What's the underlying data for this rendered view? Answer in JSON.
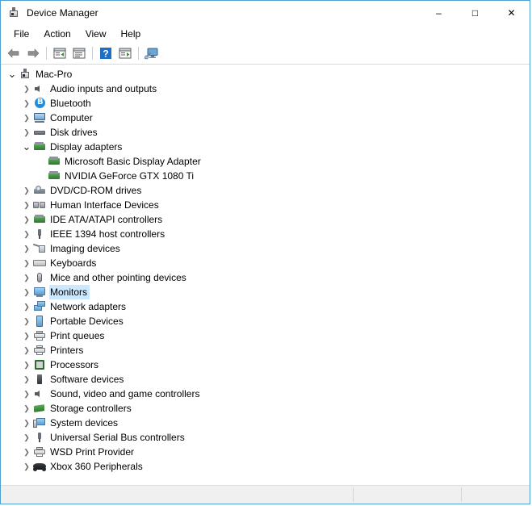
{
  "window": {
    "title": "Device Manager",
    "title_icon": "device-manager-icon",
    "controls": {
      "minimize": "–",
      "maximize": "□",
      "close": "✕"
    }
  },
  "menu": {
    "items": [
      {
        "label": "File",
        "name": "menu-file"
      },
      {
        "label": "Action",
        "name": "menu-action"
      },
      {
        "label": "View",
        "name": "menu-view"
      },
      {
        "label": "Help",
        "name": "menu-help"
      }
    ]
  },
  "toolbar": {
    "buttons": [
      {
        "name": "back-button",
        "icon": "back-arrow-icon",
        "type": "arrow-left"
      },
      {
        "name": "forward-button",
        "icon": "forward-arrow-icon",
        "type": "arrow-right"
      },
      {
        "name": "separator-1",
        "icon": "separator",
        "type": "sep"
      },
      {
        "name": "show-hide-console-tree-button",
        "icon": "console-tree-icon",
        "type": "tree"
      },
      {
        "name": "properties-button",
        "icon": "properties-icon",
        "type": "props"
      },
      {
        "name": "separator-2",
        "icon": "separator",
        "type": "sep"
      },
      {
        "name": "help-button",
        "icon": "help-question-icon",
        "type": "help"
      },
      {
        "name": "scan-hardware-changes-button",
        "icon": "scan-hardware-icon",
        "type": "scan"
      },
      {
        "name": "separator-3",
        "icon": "separator",
        "type": "sep"
      },
      {
        "name": "update-driver-button",
        "icon": "monitor-update-icon",
        "type": "monitor"
      }
    ]
  },
  "tree": {
    "selected_label": "Monitors",
    "nodes": [
      {
        "label": "Mac-Pro",
        "depth": 0,
        "state": "expanded",
        "icon": "computer-root-icon",
        "selected": false
      },
      {
        "label": "Audio inputs and outputs",
        "depth": 1,
        "state": "collapsed",
        "icon": "speaker-icon",
        "selected": false
      },
      {
        "label": "Bluetooth",
        "depth": 1,
        "state": "collapsed",
        "icon": "bluetooth-icon",
        "selected": false
      },
      {
        "label": "Computer",
        "depth": 1,
        "state": "collapsed",
        "icon": "computer-icon",
        "selected": false
      },
      {
        "label": "Disk drives",
        "depth": 1,
        "state": "collapsed",
        "icon": "disk-drive-icon",
        "selected": false
      },
      {
        "label": "Display adapters",
        "depth": 1,
        "state": "expanded",
        "icon": "display-adapter-icon",
        "selected": false
      },
      {
        "label": "Microsoft Basic Display Adapter",
        "depth": 2,
        "state": "leaf",
        "icon": "display-adapter-icon",
        "selected": false
      },
      {
        "label": "NVIDIA GeForce GTX 1080 Ti",
        "depth": 2,
        "state": "leaf",
        "icon": "display-adapter-icon",
        "selected": false
      },
      {
        "label": "DVD/CD-ROM drives",
        "depth": 1,
        "state": "collapsed",
        "icon": "dvd-drive-icon",
        "selected": false
      },
      {
        "label": "Human Interface Devices",
        "depth": 1,
        "state": "collapsed",
        "icon": "hid-icon",
        "selected": false
      },
      {
        "label": "IDE ATA/ATAPI controllers",
        "depth": 1,
        "state": "collapsed",
        "icon": "ide-controller-icon",
        "selected": false
      },
      {
        "label": "IEEE 1394 host controllers",
        "depth": 1,
        "state": "collapsed",
        "icon": "firewire-icon",
        "selected": false
      },
      {
        "label": "Imaging devices",
        "depth": 1,
        "state": "collapsed",
        "icon": "imaging-device-icon",
        "selected": false
      },
      {
        "label": "Keyboards",
        "depth": 1,
        "state": "collapsed",
        "icon": "keyboard-icon",
        "selected": false
      },
      {
        "label": "Mice and other pointing devices",
        "depth": 1,
        "state": "collapsed",
        "icon": "mouse-icon",
        "selected": false
      },
      {
        "label": "Monitors",
        "depth": 1,
        "state": "collapsed",
        "icon": "monitor-icon",
        "selected": true
      },
      {
        "label": "Network adapters",
        "depth": 1,
        "state": "collapsed",
        "icon": "network-adapter-icon",
        "selected": false
      },
      {
        "label": "Portable Devices",
        "depth": 1,
        "state": "collapsed",
        "icon": "portable-device-icon",
        "selected": false
      },
      {
        "label": "Print queues",
        "depth": 1,
        "state": "collapsed",
        "icon": "printer-icon",
        "selected": false
      },
      {
        "label": "Printers",
        "depth": 1,
        "state": "collapsed",
        "icon": "printer-icon",
        "selected": false
      },
      {
        "label": "Processors",
        "depth": 1,
        "state": "collapsed",
        "icon": "processor-icon",
        "selected": false
      },
      {
        "label": "Software devices",
        "depth": 1,
        "state": "collapsed",
        "icon": "software-device-icon",
        "selected": false
      },
      {
        "label": "Sound, video and game controllers",
        "depth": 1,
        "state": "collapsed",
        "icon": "speaker-icon",
        "selected": false
      },
      {
        "label": "Storage controllers",
        "depth": 1,
        "state": "collapsed",
        "icon": "storage-controller-icon",
        "selected": false
      },
      {
        "label": "System devices",
        "depth": 1,
        "state": "collapsed",
        "icon": "system-device-icon",
        "selected": false
      },
      {
        "label": "Universal Serial Bus controllers",
        "depth": 1,
        "state": "collapsed",
        "icon": "usb-icon",
        "selected": false
      },
      {
        "label": "WSD Print Provider",
        "depth": 1,
        "state": "collapsed",
        "icon": "printer-icon",
        "selected": false
      },
      {
        "label": "Xbox 360 Peripherals",
        "depth": 1,
        "state": "collapsed",
        "icon": "gamepad-icon",
        "selected": false
      }
    ],
    "expander_glyphs": {
      "collapsed": "❯",
      "expanded": "⌄"
    }
  },
  "statusbar": {
    "panes": [
      "",
      "",
      ""
    ]
  },
  "colors": {
    "window_border": "#4f9fd4",
    "selection": "#cce8ff",
    "statusbar_bg": "#f0f0f0",
    "help_blue": "#1f6fc4",
    "text": "#000000"
  }
}
